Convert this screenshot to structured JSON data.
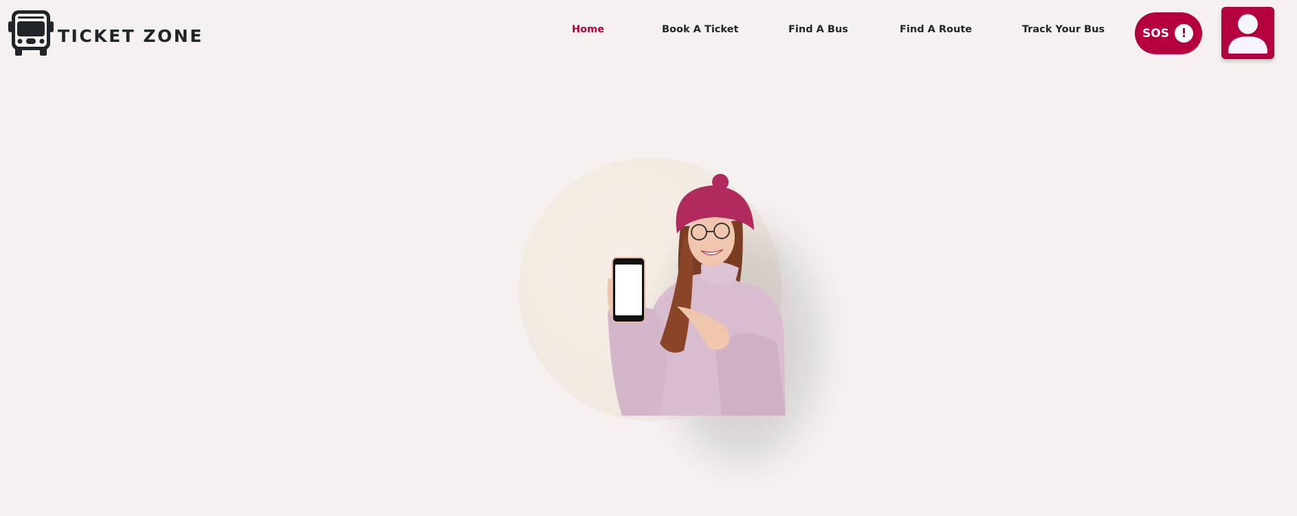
{
  "brand": {
    "name": "TICKET ZONE",
    "logo_icon": "bus-icon"
  },
  "nav": {
    "items": [
      {
        "label": "Home",
        "active": true
      },
      {
        "label": "Book A Ticket",
        "active": false
      },
      {
        "label": "Find A Bus",
        "active": false
      },
      {
        "label": "Find A Route",
        "active": false
      },
      {
        "label": "Track Your Bus",
        "active": false
      }
    ]
  },
  "sos": {
    "label": "SOS",
    "icon": "exclamation-circle-icon"
  },
  "profile": {
    "icon": "user-icon"
  },
  "colors": {
    "accent": "#b5003f",
    "background": "#f4f1f0",
    "text": "#212529",
    "hero_circle": "#f5eee6"
  },
  "hero": {
    "image": "woman-holding-phone-illustration"
  }
}
